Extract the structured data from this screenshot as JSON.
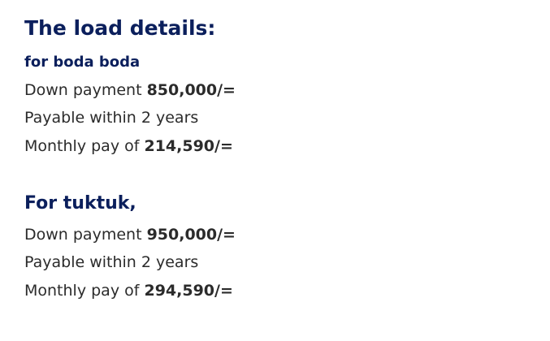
{
  "title": "The load details:",
  "sections": [
    {
      "heading": "for boda boda",
      "down_payment_label": "Down payment",
      "down_payment_value": "850,000/=",
      "payable_text": "Payable within 2 years",
      "monthly_label": "Monthly pay of",
      "monthly_value": "214,590/="
    },
    {
      "heading": "For tuktuk,",
      "down_payment_label": "Down payment",
      "down_payment_value": "950,000/=",
      "payable_text": "Payable within 2 years",
      "monthly_label": "Monthly pay of",
      "monthly_value": "294,590/="
    }
  ],
  "colors": {
    "heading": "#0b1f5c",
    "body_text": "#2b2b2b",
    "background": "#ffffff"
  }
}
